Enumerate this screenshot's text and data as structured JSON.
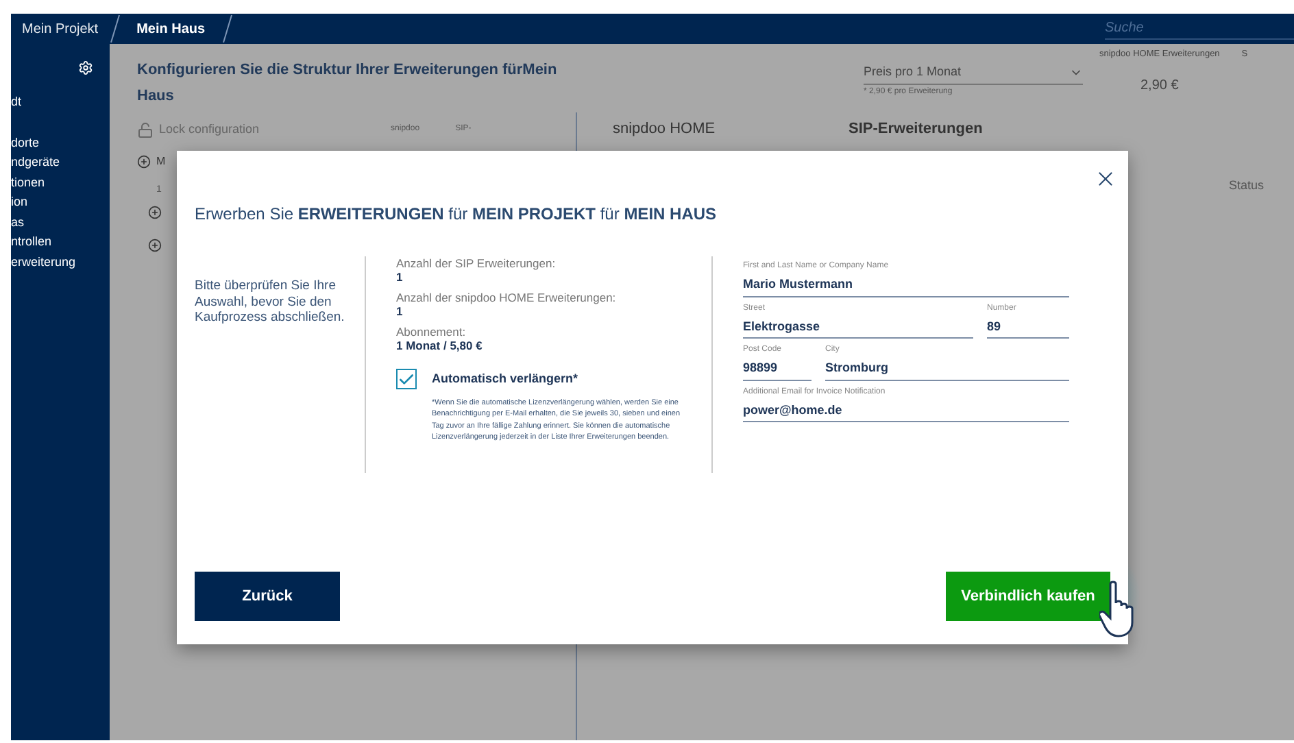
{
  "breadcrumbs": [
    {
      "label": "Mein Projekt",
      "selected": false
    },
    {
      "label": "Mein Haus",
      "selected": true
    }
  ],
  "search": {
    "placeholder": "Suche"
  },
  "sidebar": {
    "items": [
      "dt",
      "dorte",
      "ndgeräte",
      "tionen",
      "ion",
      "as",
      "ntrollen",
      "erweiterung"
    ]
  },
  "main": {
    "heading": "Konfigurieren Sie die Struktur Ihrer Erweiterungen für**Mein Haus**",
    "price_select": {
      "value": "Preis pro 1 Monat",
      "caption": "* 2,90 € pro Erweiterung"
    },
    "summary": {
      "label": "snipdoo HOME Erweiterungen",
      "value": "2,90 €",
      "column_2": "S"
    },
    "lock": "Lock configuration",
    "columns": [
      "snipdoo",
      "SIP-"
    ],
    "tree": [
      "M",
      "1"
    ],
    "right_panel": {
      "headers": [
        "snipdoo HOME",
        "SIP-Erweiterungen"
      ],
      "status": "Status"
    }
  },
  "modal": {
    "title": "Erwerben Sie **ERWEITERUNGEN** für **MEIN PROJEKT** für **MEIN HAUS**",
    "intro": "Bitte überprüfen Sie Ihre Auswahl, bevor Sie den Kaufprozess abschließen.",
    "facts": [
      {
        "label": "Anzahl der SIP Erweiterungen:",
        "value": "1"
      },
      {
        "label": "Anzahl der snipdoo HOME Erweiterungen:",
        "value": "1"
      },
      {
        "label": "Abonnement:",
        "value": "1 Monat / 5,80 €"
      }
    ],
    "auto_renew": {
      "label": "Automatisch verlängern*",
      "checked": true,
      "note": "*Wenn Sie die automatische Lizenzverlängerung wählen, werden Sie eine Benachrichtigung per E-Mail erhalten, die Sie jeweils 30, sieben und einen Tag zuvor an Ihre fällige Zahlung erinnert. Sie können die automatische Lizenzverlängerung jederzeit in der Liste Ihrer Erweiterungen beenden."
    },
    "form_rows": [
      [
        {
          "label": "First and Last Name or Company Name",
          "value": "Mario Mustermann"
        }
      ],
      [
        {
          "label": "Street",
          "value": "Elektrogasse"
        },
        {
          "label": "Number",
          "value": "89"
        }
      ],
      [
        {
          "label": "Post Code",
          "value": "98899"
        },
        {
          "label": "City",
          "value": "Stromburg"
        }
      ],
      [
        {
          "label": "Additional Email for Invoice Notification",
          "value": "power@home.de"
        }
      ]
    ],
    "back_button": "Zurück",
    "buy_button": "Verbindlich kaufen"
  }
}
